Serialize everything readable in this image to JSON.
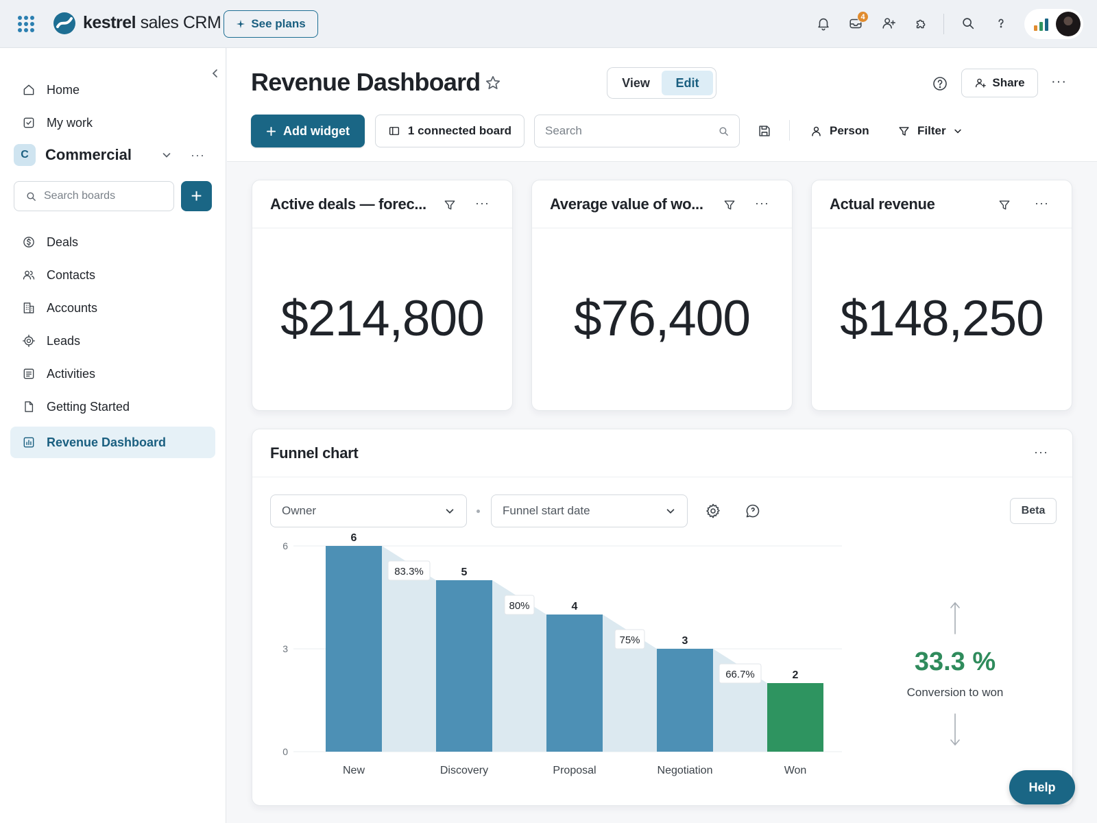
{
  "topbar": {
    "brand_bold": "kestrel",
    "brand_rest": " sales CRM",
    "see_plans_label": "See plans",
    "inbox_badge": "4",
    "icons": [
      "apps-grid-icon",
      "bell-icon",
      "inbox-icon",
      "invite-user-icon",
      "puzzle-icon",
      "search-icon",
      "help-icon"
    ]
  },
  "sidebar": {
    "top_items": [
      {
        "label": "Home",
        "icon": "home-icon"
      },
      {
        "label": "My work",
        "icon": "checkbox-icon"
      }
    ],
    "workspace": {
      "initial": "C",
      "name": "Commercial"
    },
    "search_placeholder": "Search boards",
    "add_label": "+",
    "boards": [
      {
        "label": "Deals",
        "icon": "dollar-icon"
      },
      {
        "label": "Contacts",
        "icon": "contacts-icon"
      },
      {
        "label": "Accounts",
        "icon": "building-icon"
      },
      {
        "label": "Leads",
        "icon": "target-icon"
      },
      {
        "label": "Activities",
        "icon": "list-icon"
      },
      {
        "label": "Getting Started",
        "icon": "document-icon"
      },
      {
        "label": "Revenue Dashboard",
        "icon": "dashboard-icon",
        "active": true
      }
    ]
  },
  "header": {
    "title": "Revenue Dashboard",
    "view_label": "View",
    "edit_label": "Edit",
    "active_mode": "Edit",
    "share_label": "Share"
  },
  "toolbar": {
    "add_widget_label": "Add widget",
    "connected_board_label": "1 connected board",
    "search_placeholder": "Search",
    "person_label": "Person",
    "filter_label": "Filter"
  },
  "widgets": [
    {
      "title": "Active deals — forec...",
      "value": "$214,800"
    },
    {
      "title": "Average value of wo...",
      "value": "$76,400"
    },
    {
      "title": "Actual revenue",
      "value": "$148,250"
    }
  ],
  "funnel": {
    "title": "Funnel chart",
    "owner_select": "Owner",
    "date_select": "Funnel start date",
    "beta_label": "Beta",
    "conversion_value": "33.3 %",
    "conversion_label": "Conversion to won"
  },
  "chart_data": {
    "type": "bar",
    "categories": [
      "New",
      "Discovery",
      "Proposal",
      "Negotiation",
      "Won"
    ],
    "values": [
      6,
      5,
      4,
      3,
      2
    ],
    "step_conversions": [
      "83.3%",
      "80%",
      "75%",
      "66.7%"
    ],
    "yticks": [
      0,
      3,
      6
    ],
    "ylim": [
      0,
      6
    ],
    "grid": true,
    "colors": {
      "bar": "#4d90b5",
      "won": "#2e9460",
      "connector": "#dce9f0"
    }
  },
  "help_label": "Help"
}
